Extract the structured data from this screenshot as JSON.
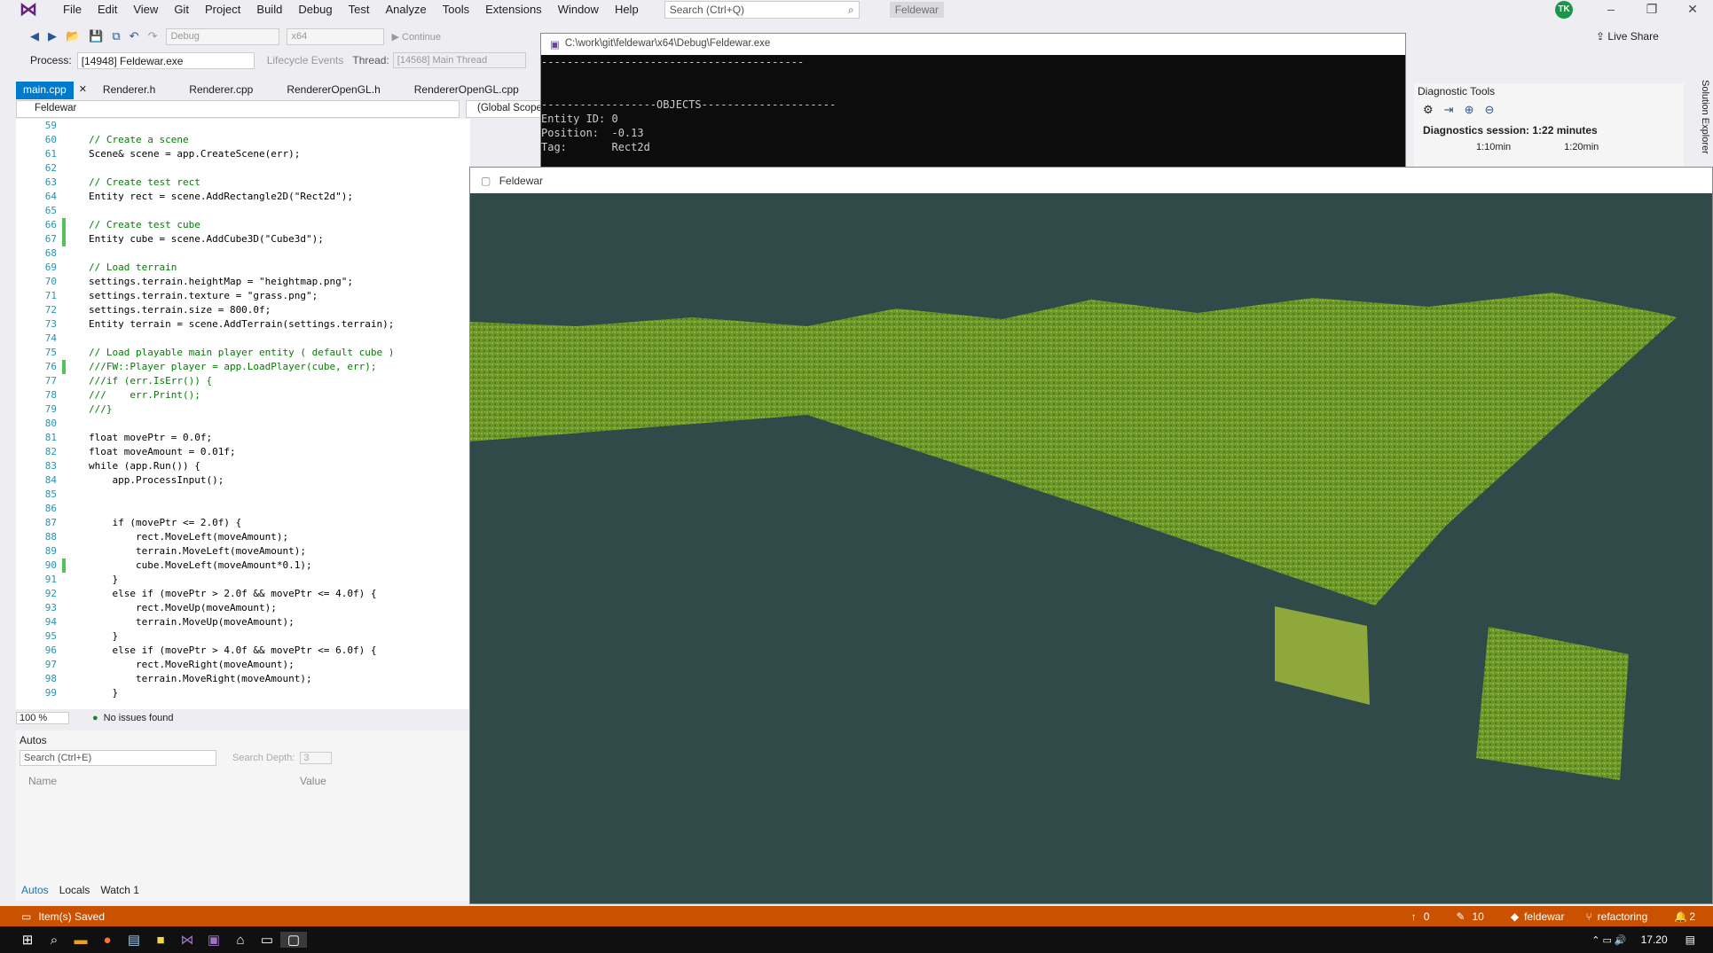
{
  "menubar": {
    "items": [
      "File",
      "Edit",
      "View",
      "Git",
      "Project",
      "Build",
      "Debug",
      "Test",
      "Analyze",
      "Tools",
      "Extensions",
      "Window",
      "Help"
    ],
    "search_placeholder": "Search (Ctrl+Q)",
    "solution_name": "Feldewar",
    "avatar": "TK"
  },
  "toolbar": {
    "config": "Debug",
    "platform": "x64",
    "continue_label": "Continue",
    "live_share": "Live Share"
  },
  "procbar": {
    "process_label": "Process:",
    "process_value": "[14948] Feldewar.exe",
    "lifecycle": "Lifecycle Events",
    "thread_label": "Thread:",
    "thread_value": "[14568] Main Thread"
  },
  "tabs": [
    "main.cpp",
    "Renderer.h",
    "Renderer.cpp",
    "RendererOpenGL.h",
    "RendererOpenGL.cpp"
  ],
  "nav": {
    "project": "Feldewar",
    "scope": "(Global Scope)"
  },
  "code": [
    {
      "n": "59",
      "t": ""
    },
    {
      "n": "60",
      "t": "// Create a scene"
    },
    {
      "n": "61",
      "t": "Scene& scene = app.CreateScene(err);"
    },
    {
      "n": "62",
      "t": ""
    },
    {
      "n": "63",
      "t": "// Create test rect"
    },
    {
      "n": "64",
      "t": "Entity rect = scene.AddRectangle2D(\"Rect2d\");"
    },
    {
      "n": "65",
      "t": ""
    },
    {
      "n": "66",
      "t": "// Create test cube"
    },
    {
      "n": "67",
      "t": "Entity cube = scene.AddCube3D(\"Cube3d\");"
    },
    {
      "n": "68",
      "t": ""
    },
    {
      "n": "69",
      "t": "// Load terrain"
    },
    {
      "n": "70",
      "t": "settings.terrain.heightMap = \"heightmap.png\";"
    },
    {
      "n": "71",
      "t": "settings.terrain.texture = \"grass.png\";"
    },
    {
      "n": "72",
      "t": "settings.terrain.size = 800.0f;"
    },
    {
      "n": "73",
      "t": "Entity terrain = scene.AddTerrain(settings.terrain);"
    },
    {
      "n": "74",
      "t": ""
    },
    {
      "n": "75",
      "t": "// Load playable main player entity ( default cube )"
    },
    {
      "n": "76",
      "t": "///FW::Player player = app.LoadPlayer(cube, err);"
    },
    {
      "n": "77",
      "t": "///if (err.IsErr()) {"
    },
    {
      "n": "78",
      "t": "///    err.Print();"
    },
    {
      "n": "79",
      "t": "///}"
    },
    {
      "n": "80",
      "t": ""
    },
    {
      "n": "81",
      "t": "float movePtr = 0.0f;"
    },
    {
      "n": "82",
      "t": "float moveAmount = 0.01f;"
    },
    {
      "n": "83",
      "t": "while (app.Run()) {"
    },
    {
      "n": "84",
      "t": "    app.ProcessInput();"
    },
    {
      "n": "85",
      "t": ""
    },
    {
      "n": "86",
      "t": ""
    },
    {
      "n": "87",
      "t": "    if (movePtr <= 2.0f) {"
    },
    {
      "n": "88",
      "t": "        rect.MoveLeft(moveAmount);"
    },
    {
      "n": "89",
      "t": "        terrain.MoveLeft(moveAmount);"
    },
    {
      "n": "90",
      "t": "        cube.MoveLeft(moveAmount*0.1);"
    },
    {
      "n": "91",
      "t": "    }"
    },
    {
      "n": "92",
      "t": "    else if (movePtr > 2.0f && movePtr <= 4.0f) {"
    },
    {
      "n": "93",
      "t": "        rect.MoveUp(moveAmount);"
    },
    {
      "n": "94",
      "t": "        terrain.MoveUp(moveAmount);"
    },
    {
      "n": "95",
      "t": "    }"
    },
    {
      "n": "96",
      "t": "    else if (movePtr > 4.0f && movePtr <= 6.0f) {"
    },
    {
      "n": "97",
      "t": "        rect.MoveRight(moveAmount);"
    },
    {
      "n": "98",
      "t": "        terrain.MoveRight(moveAmount);"
    },
    {
      "n": "99",
      "t": "    }"
    }
  ],
  "editor_status": {
    "zoom": "100 %",
    "issues": "No issues found"
  },
  "autos": {
    "title": "Autos",
    "search_placeholder": "Search (Ctrl+E)",
    "search_depth_label": "Search Depth:",
    "search_depth": "3",
    "col_name": "Name",
    "col_value": "Value",
    "tabs": [
      "Autos",
      "Locals",
      "Watch 1"
    ]
  },
  "console": {
    "title": "C:\\work\\git\\feldewar\\x64\\Debug\\Feldewar.exe",
    "lines": [
      "-----------------------------------------",
      "",
      "",
      "------------------OBJECTS---------------------",
      "Entity ID: 0",
      "Position:  -0.13",
      "Tag:       Rect2d"
    ]
  },
  "diag": {
    "title": "Diagnostic Tools",
    "session": "Diagnostics session: 1:22 minutes",
    "t1": "1:10min",
    "t2": "1:20min"
  },
  "solution_explorer": "Solution Explorer",
  "game": {
    "title": "Feldewar"
  },
  "statusbar": {
    "message": "Item(s) Saved",
    "up": "0",
    "pencil": "10",
    "repo": "feldewar",
    "branch": "refactoring",
    "notifications": "2"
  },
  "taskbar": {
    "time": "17.20"
  },
  "colors": {
    "accent": "#007acc",
    "status": "#ca5100",
    "scene_bg": "#2f4a48",
    "grass": "#6f9b2c"
  }
}
